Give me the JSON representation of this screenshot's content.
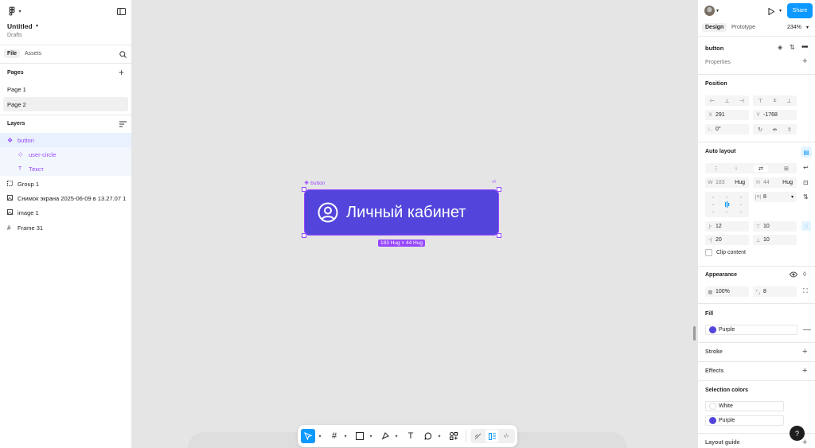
{
  "left": {
    "file_name": "Untitled",
    "file_location": "Drafts",
    "tabs": [
      "File",
      "Assets"
    ],
    "pages_title": "Pages",
    "pages": [
      "Page 1",
      "Page 2"
    ],
    "layers_title": "Layers",
    "layers": [
      {
        "name": "button",
        "type": "component"
      },
      {
        "name": "user-circle",
        "type": "instance"
      },
      {
        "name": "Текст",
        "type": "text"
      },
      {
        "name": "Group 1",
        "type": "group"
      },
      {
        "name": "Снимок экрана 2025-06-09 в 13.27.07 1",
        "type": "image"
      },
      {
        "name": "image 1",
        "type": "image"
      },
      {
        "name": "Frame 31",
        "type": "frame"
      }
    ]
  },
  "canvas": {
    "selection_label": "button",
    "button_text": "Личный кабинет",
    "size_badge": "183 Hug × 44 Hug"
  },
  "right": {
    "share_label": "Share",
    "tabs": [
      "Design",
      "Prototype"
    ],
    "zoom": "234%",
    "selection_name": "button",
    "properties_title": "Properties",
    "position_title": "Position",
    "x_label": "X",
    "x_value": "291",
    "y_label": "Y",
    "y_value": "-1768",
    "rotation_value": "0°",
    "autolayout_title": "Auto layout",
    "w_label": "W",
    "w_value": "183",
    "w_mode": "Hug",
    "h_label": "H",
    "h_value": "44",
    "h_mode": "Hug",
    "gap_value": "8",
    "pad_left": "12",
    "pad_top": "10",
    "pad_right": "20",
    "pad_bottom": "10",
    "clip_label": "Clip content",
    "appearance_title": "Appearance",
    "opacity_value": "100%",
    "radius_value": "8",
    "fill_title": "Fill",
    "fill_name": "Purple",
    "stroke_title": "Stroke",
    "effects_title": "Effects",
    "selection_colors_title": "Selection colors",
    "sel_colors": [
      {
        "name": "White",
        "hex": "#ffffff"
      },
      {
        "name": "Purple",
        "hex": "#5345dc"
      }
    ],
    "layout_guide_title": "Layout guide",
    "help_label": "?"
  },
  "colors": {
    "accent": "#0d99ff",
    "component": "#9747ff",
    "purple": "#5345dc"
  }
}
